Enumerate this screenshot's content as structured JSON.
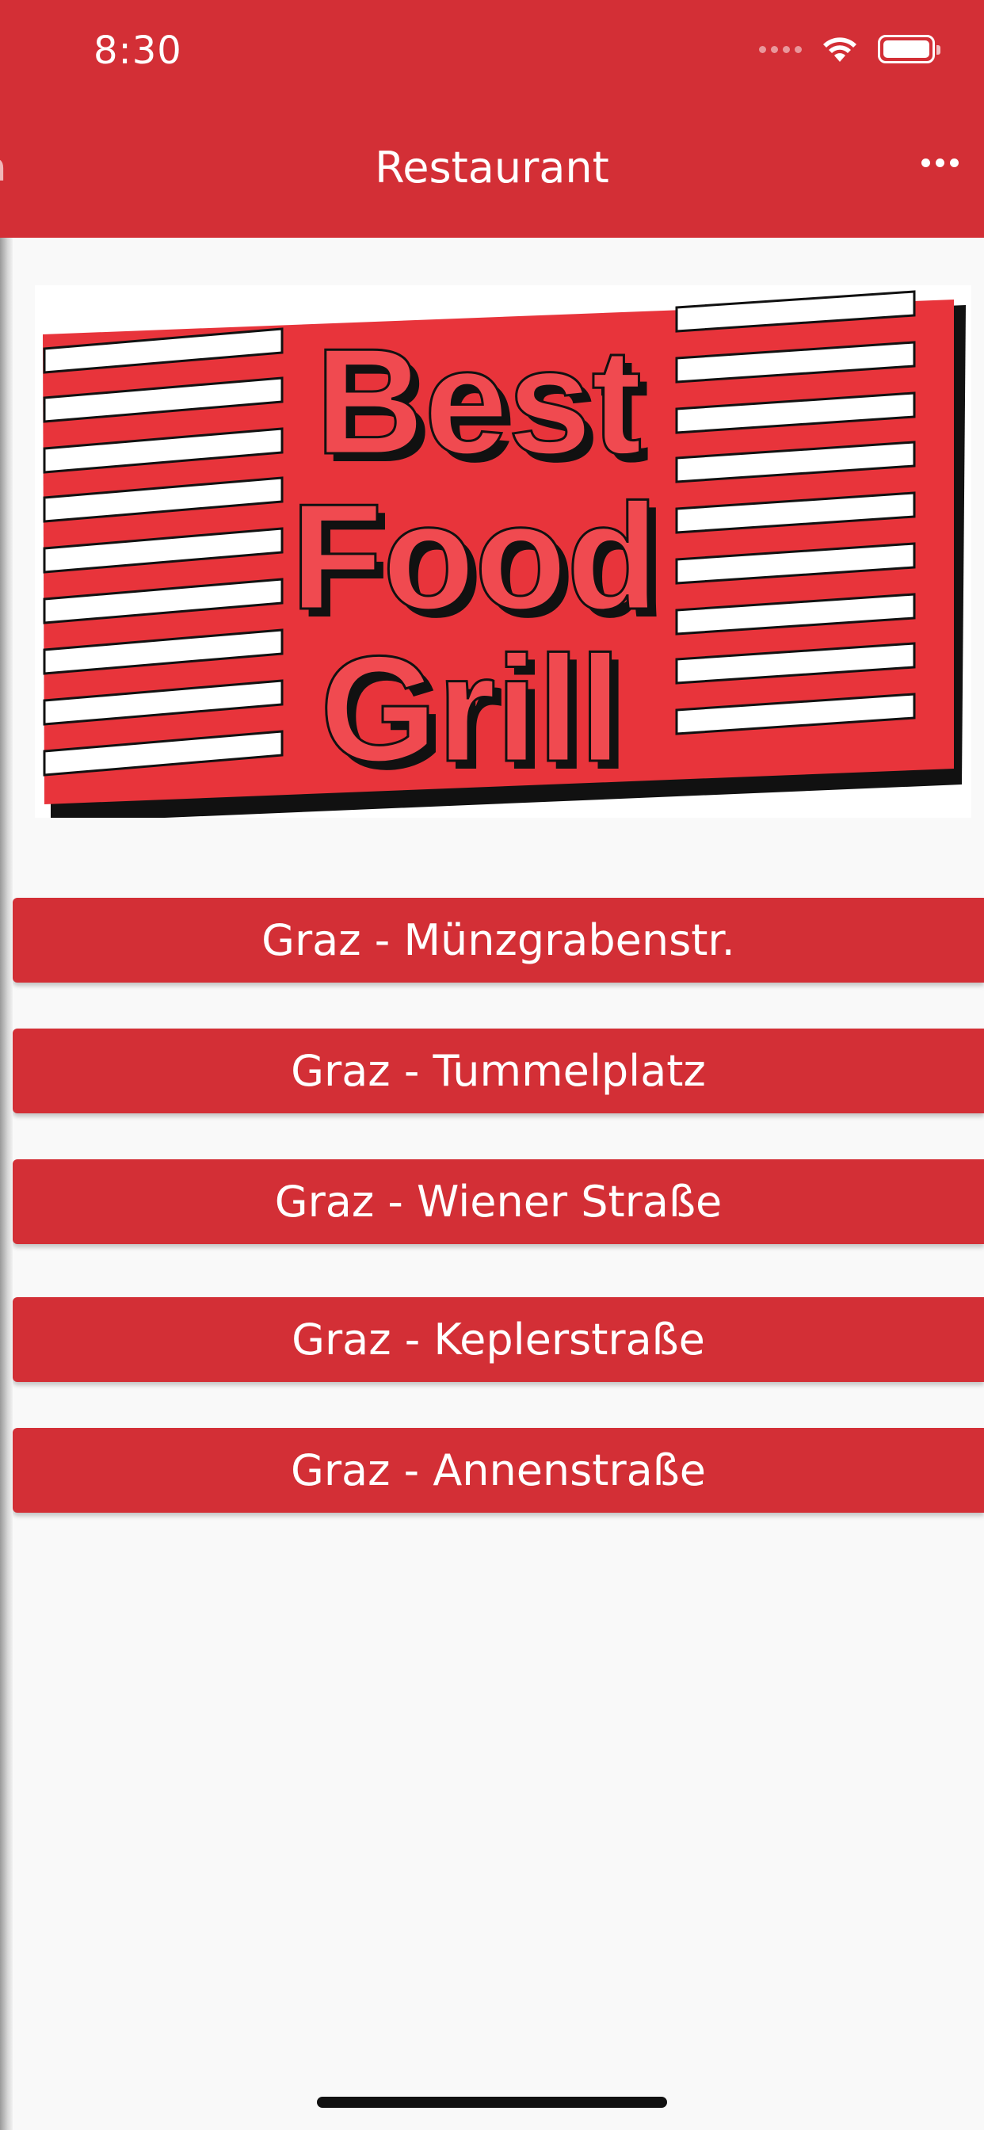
{
  "status_bar": {
    "time": "8:30"
  },
  "nav": {
    "title": "Restaurant",
    "back_peek": "a",
    "more_icon": "ellipsis-icon"
  },
  "logo": {
    "line1": "Best",
    "line2": "Food",
    "line3": "Grill"
  },
  "branches": [
    {
      "label": "Graz - Münzgrabenstr."
    },
    {
      "label": "Graz - Tummelplatz"
    },
    {
      "label": "Graz - Wiener Straße"
    },
    {
      "label": "Graz - Keplerstraße"
    },
    {
      "label": "Graz - Annenstraße"
    }
  ],
  "colors": {
    "accent": "#d32f36",
    "background": "#f9f9f9",
    "logo_red": "#f04a50"
  }
}
